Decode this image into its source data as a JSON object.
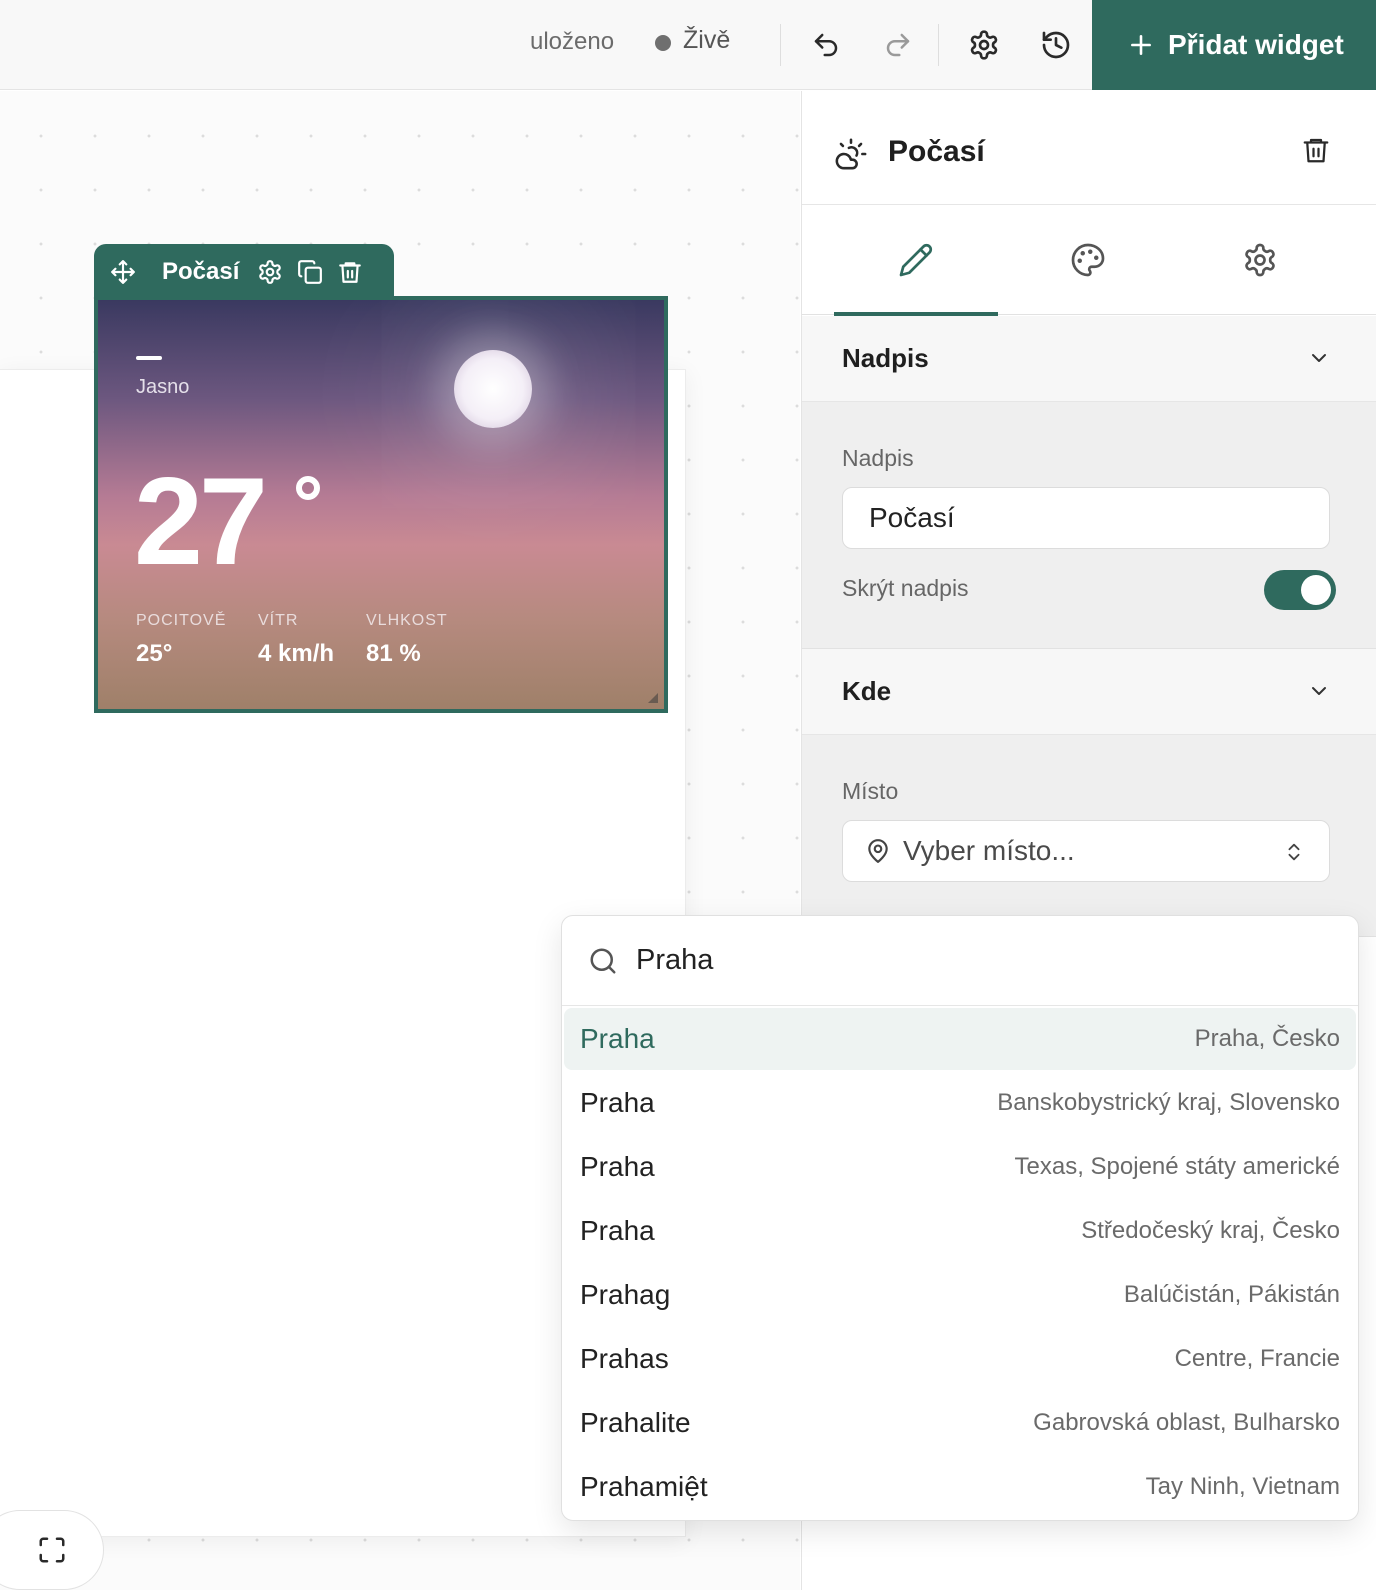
{
  "topbar": {
    "saved_status": "uloženo",
    "live_status": "Živě",
    "add_widget_label": "Přidat widget",
    "accent_color": "#2f6a5e"
  },
  "widget": {
    "toolbar_title": "Počasí",
    "condition_dash": "—",
    "condition": "Jasno",
    "temperature": "27",
    "metrics": [
      {
        "label": "POCITOVĚ",
        "value": "25°"
      },
      {
        "label": "VÍTR",
        "value": "4 km/h"
      },
      {
        "label": "VLHKOST",
        "value": "81 %"
      }
    ]
  },
  "panel": {
    "title": "Počasí",
    "tabs": [
      "pencil-icon",
      "palette-icon",
      "gear-icon"
    ],
    "active_tab": 0,
    "sections": {
      "heading": {
        "title": "Nadpis",
        "field_label": "Nadpis",
        "field_value": "Počasí",
        "toggle_label": "Skrýt nadpis",
        "toggle_on": true
      },
      "where": {
        "title": "Kde",
        "field_label": "Místo",
        "select_placeholder": "Vyber místo..."
      }
    }
  },
  "dropdown": {
    "search_value": "Praha",
    "options": [
      {
        "name": "Praha",
        "region": "Praha, Česko",
        "highlighted": true
      },
      {
        "name": "Praha",
        "region": "Banskobystrický kraj, Slovensko"
      },
      {
        "name": "Praha",
        "region": "Texas, Spojené státy americké"
      },
      {
        "name": "Praha",
        "region": "Středočeský kraj, Česko"
      },
      {
        "name": "Prahag",
        "region": "Balúčistán, Pákistán"
      },
      {
        "name": "Prahas",
        "region": "Centre, Francie"
      },
      {
        "name": "Prahalite",
        "region": "Gabrovská oblast, Bulharsko"
      },
      {
        "name": "Prahamiệt",
        "region": "Tay Ninh, Vietnam"
      }
    ]
  }
}
